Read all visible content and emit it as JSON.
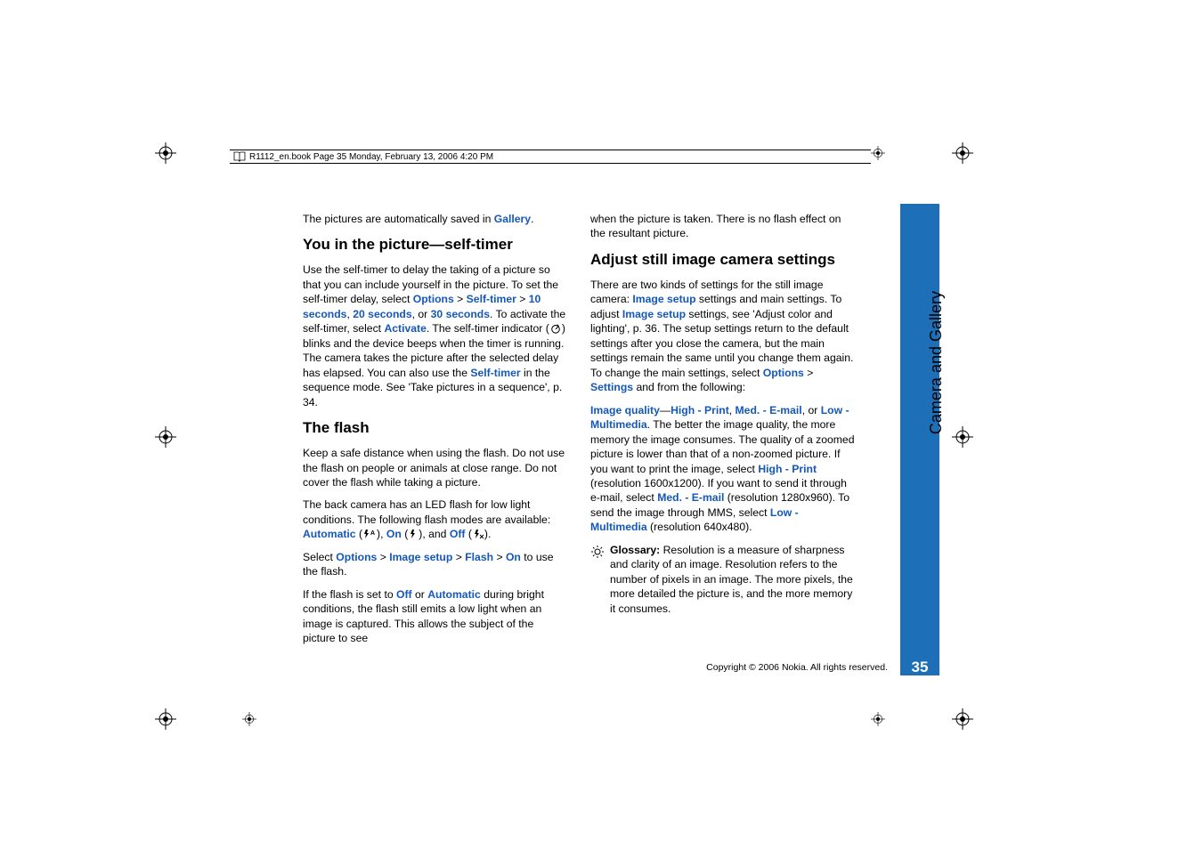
{
  "header_line": "R1112_en.book  Page 35  Monday, February 13, 2006  4:20 PM",
  "side_tab_label": "Camera and Gallery",
  "page_number": "35",
  "copyright": "Copyright © 2006 Nokia. All rights reserved.",
  "col1": {
    "p1_a": "The pictures are automatically saved in ",
    "p1_link": "Gallery",
    "p1_b": ".",
    "h1": "You in the picture—self-timer",
    "p2_a": "Use the self-timer to delay the taking of a picture so that you can include yourself in the picture. To set the self-timer delay, select ",
    "p2_opt": "Options",
    "p2_gt": " > ",
    "p2_st": "Self-timer",
    "p2_10": "10 seconds",
    "p2_comma": ", ",
    "p2_20": "20 seconds",
    "p2_or": ", or ",
    "p2_30": "30 seconds",
    "p2_b": ". To activate the self-timer, select ",
    "p2_act": "Activate",
    "p2_c": ". The self-timer indicator (",
    "p2_d": ") blinks and the device beeps when the timer is running. The camera takes the picture after the selected delay has elapsed. You can also use the ",
    "p2_st2": "Self-timer",
    "p2_e": " in the sequence mode. See 'Take pictures in a sequence', p. 34.",
    "h2": "The flash",
    "p3": "Keep a safe distance when using the flash. Do not use the flash on people or animals at close range. Do not cover the flash while taking a picture.",
    "p4_a": "The back camera has an LED flash for low light conditions. The following flash modes are available: ",
    "p4_auto": "Automatic",
    "p4_b": " (",
    "p4_c": "), ",
    "p4_on": "On",
    "p4_d": " (",
    "p4_e": "), and ",
    "p4_off": "Off",
    "p4_f": " (",
    "p4_g": ").",
    "p5_a": "Select ",
    "p5_opt": "Options",
    "p5_gt": " > ",
    "p5_is": "Image setup",
    "p5_fl": "Flash",
    "p5_on": "On",
    "p5_b": " to use the flash.",
    "p6_a": "If the flash is set to ",
    "p6_off": "Off",
    "p6_or": " or ",
    "p6_auto": "Automatic",
    "p6_b": " during bright conditions, the flash still emits a low light when an image is captured. This allows the subject of the picture to see"
  },
  "col2": {
    "p1": "when the picture is taken. There is no flash effect on the resultant picture.",
    "h1": "Adjust still image camera settings",
    "p2_a": "There are two kinds of settings for the still image camera: ",
    "p2_is": "Image setup",
    "p2_b": " settings and main settings. To adjust ",
    "p2_is2": "Image setup",
    "p2_c": " settings, see 'Adjust color and lighting', p. 36. The setup settings return to the default settings after you close the camera, but the main settings remain the same until you change them again. To change the main settings, select ",
    "p2_opt": "Options",
    "p2_gt": " > ",
    "p2_set": "Settings",
    "p2_d": " and from the following:",
    "p3_iq": "Image quality",
    "p3_dash": "—",
    "p3_hp": "High - Print",
    "p3_comma": ", ",
    "p3_me": "Med. - E-mail",
    "p3_or": ", or ",
    "p3_lm": "Low - Multimedia",
    "p3_a": ". The better the image quality, the more memory the image consumes. The quality of a zoomed picture is lower than that of a non-zoomed picture. If you want to print the image, select ",
    "p3_hp2": "High - Print",
    "p3_b": " (resolution 1600x1200). If you want to send it through e-mail, select ",
    "p3_me2": "Med. - E-mail",
    "p3_c": " (resolution 1280x960). To send the image through MMS, select ",
    "p3_lm2": "Low - Multimedia",
    "p3_d": " (resolution 640x480).",
    "gloss_label": "Glossary:",
    "gloss_text": " Resolution is a measure of sharpness and clarity of an image. Resolution refers to the number of pixels in an image. The more pixels, the more detailed the picture is, and the more memory it consumes."
  }
}
